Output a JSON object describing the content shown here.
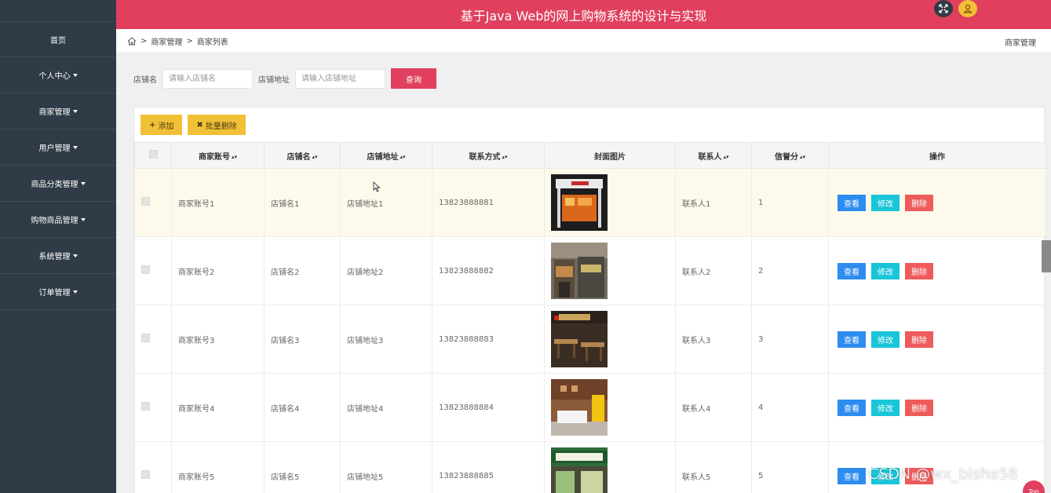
{
  "header": {
    "title": "基于Java Web的网上购物系统的设计与实现"
  },
  "sidebar": {
    "items": [
      {
        "label": "首页",
        "dropdown": false
      },
      {
        "label": "个人中心",
        "dropdown": true
      },
      {
        "label": "商家管理",
        "dropdown": true
      },
      {
        "label": "用户管理",
        "dropdown": true
      },
      {
        "label": "商品分类管理",
        "dropdown": true
      },
      {
        "label": "购物商品管理",
        "dropdown": true
      },
      {
        "label": "系统管理",
        "dropdown": true
      },
      {
        "label": "订单管理",
        "dropdown": true
      }
    ]
  },
  "breadcrumb": {
    "items": [
      "商家管理",
      "商家列表"
    ],
    "separator": ">",
    "right": "商家管理"
  },
  "search": {
    "shop_name_label": "店铺名",
    "shop_name_placeholder": "请输入店铺名",
    "shop_addr_label": "店铺地址",
    "shop_addr_placeholder": "请输入店铺地址",
    "query_label": "查询"
  },
  "toolbar": {
    "add_label": "添加",
    "batch_delete_label": "批量删除"
  },
  "table": {
    "columns": [
      "商家账号",
      "店铺名",
      "店铺地址",
      "联系方式",
      "封面图片",
      "联系人",
      "信誉分",
      "操作"
    ],
    "rows": [
      {
        "account": "商家账号1",
        "name": "店铺名1",
        "address": "店铺地址1",
        "phone": "13823888881",
        "contact": "联系人1",
        "score": "1"
      },
      {
        "account": "商家账号2",
        "name": "店铺名2",
        "address": "店铺地址2",
        "phone": "13823888882",
        "contact": "联系人2",
        "score": "2"
      },
      {
        "account": "商家账号3",
        "name": "店铺名3",
        "address": "店铺地址3",
        "phone": "13823888883",
        "contact": "联系人3",
        "score": "3"
      },
      {
        "account": "商家账号4",
        "name": "店铺名4",
        "address": "店铺地址4",
        "phone": "13823888884",
        "contact": "联系人4",
        "score": "4"
      },
      {
        "account": "商家账号5",
        "name": "店铺名5",
        "address": "店铺地址5",
        "phone": "13823888885",
        "contact": "联系人5",
        "score": "5"
      }
    ],
    "actions": {
      "view": "查看",
      "edit": "修改",
      "delete": "删除"
    }
  },
  "misc": {
    "top_label": "Top",
    "watermark": "CSDN @wx_bishe58"
  },
  "colors": {
    "brand": "#e0405e",
    "sidebar": "#2f3b46",
    "toolbar_button": "#f2c037",
    "view": "#2d8cf0",
    "edit": "#19c5d8",
    "delete": "#ee5b5b"
  }
}
